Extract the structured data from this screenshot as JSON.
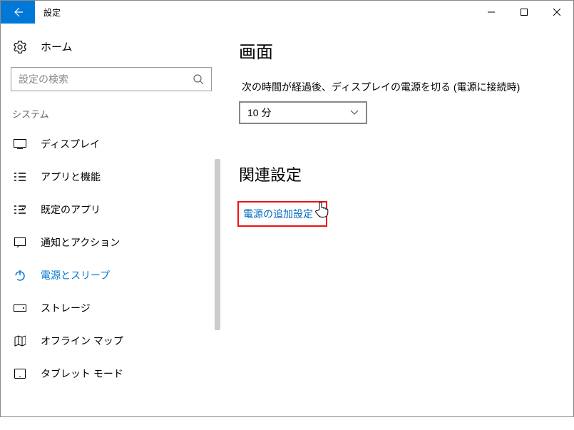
{
  "titlebar": {
    "app_title": "設定"
  },
  "sidebar": {
    "home_label": "ホーム",
    "search_placeholder": "設定の検索",
    "section_label": "システム",
    "items": [
      {
        "icon": "display-icon",
        "label": "ディスプレイ"
      },
      {
        "icon": "apps-icon",
        "label": "アプリと機能"
      },
      {
        "icon": "defaults-icon",
        "label": "既定のアプリ"
      },
      {
        "icon": "notifications-icon",
        "label": "通知とアクション"
      },
      {
        "icon": "power-icon",
        "label": "電源とスリープ",
        "active": true
      },
      {
        "icon": "storage-icon",
        "label": "ストレージ"
      },
      {
        "icon": "map-icon",
        "label": "オフライン マップ"
      },
      {
        "icon": "tablet-icon",
        "label": "タブレット モード"
      }
    ]
  },
  "main": {
    "section1_title": "画面",
    "screen_off_label": "次の時間が経過後、ディスプレイの電源を切る (電源に接続時)",
    "screen_off_value": "10 分",
    "related_title": "関連設定",
    "related_link": "電源の追加設定"
  }
}
